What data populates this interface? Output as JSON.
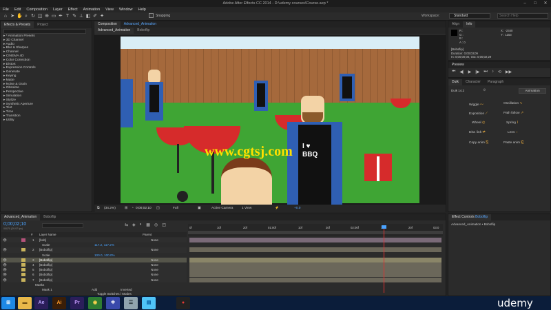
{
  "app": {
    "title": "Adobe After Effects CC 2014 - D:\\udemy courses\\Course.aep *",
    "minimize": "–",
    "maximize": "□",
    "close": "✕"
  },
  "menu": [
    "File",
    "Edit",
    "Composition",
    "Layer",
    "Effect",
    "Animation",
    "View",
    "Window",
    "Help"
  ],
  "toolbar": {
    "snapping_label": "Snapping",
    "workspace_label": "Workspace:",
    "workspace_value": "Standard",
    "search_placeholder": "Search Help"
  },
  "effects_panel": {
    "tabs": [
      "Effects & Presets",
      "Project"
    ],
    "search_placeholder": "",
    "items": [
      "* Animation Presets",
      "3D Channel",
      "Audio",
      "Blur & Sharpen",
      "Channel",
      "CINEMA 4D",
      "Color Correction",
      "Distort",
      "Expression Controls",
      "Generate",
      "Keying",
      "Matte",
      "Noise & Grain",
      "Obsolete",
      "Perspective",
      "Simulation",
      "Stylize",
      "Synthetic Aperture",
      "Text",
      "Time",
      "Transition",
      "Utility"
    ]
  },
  "composition": {
    "panel_title": "Composition",
    "panel_name": "Advanced_Animation",
    "tabs": [
      "Advanced_Animation",
      "Boboflip"
    ],
    "footer": {
      "zoom": "(34.2%)",
      "time": "0;00;02;10",
      "resolution": "Full",
      "camera": "Active Camera",
      "views": "1 View",
      "offset": "+0.0"
    },
    "watermark": "www.cgtsj.com",
    "apron": {
      "heart_line": "I ♥",
      "bbq": "BBQ"
    }
  },
  "info_panel": {
    "tabs": [
      "Align",
      "Info"
    ],
    "readouts": [
      "R :",
      "G :",
      "B :",
      "A : 0"
    ],
    "coords": [
      "X : -2340",
      "Y : 1153"
    ],
    "layer_name": "[Boboflip]",
    "lines": [
      "Duration: 0;00;03;09",
      "In: 0;00;00;00, Out: 0;00;02;29"
    ]
  },
  "preview_panel": {
    "title": "Preview"
  },
  "duik_panel": {
    "tabs": [
      "Duik",
      "Character",
      "Paragraph"
    ],
    "version": "Duik 14.2",
    "dropdown": "Animation",
    "tools": [
      {
        "label": "Wiggle",
        "icon": "〰"
      },
      {
        "label": "Oscillation",
        "icon": "∿"
      },
      {
        "label": "Exposition",
        "icon": "⟋"
      },
      {
        "label": "Path follow",
        "icon": "↗"
      },
      {
        "label": "Wheel",
        "icon": "◴"
      },
      {
        "label": "Spring",
        "icon": "⌇"
      },
      {
        "label": "Dist. link",
        "icon": "⇄"
      },
      {
        "label": "Lens",
        "icon": "◌"
      },
      {
        "label": "Copy anim",
        "icon": "⎘"
      },
      {
        "label": "Paste anim",
        "icon": "⎗"
      }
    ]
  },
  "effect_controls": {
    "title": "Effect Controls",
    "layer": "Boboflip",
    "path": "Advanced_Animation • Boboflip"
  },
  "timeline": {
    "tabs": [
      "Advanced_Animation",
      "Boboflip"
    ],
    "current_time": "0;00;02;10",
    "fps_hint": "00070 (29.97 fps)",
    "search_placeholder": "",
    "col_header": {
      "num": "#",
      "name": "Layer Name",
      "parent": "Parent"
    },
    "ruler": [
      "0f",
      "10f",
      "20f",
      "01:00f",
      "10f",
      "20f",
      "02:00f",
      "10f",
      "20f",
      "03:0"
    ],
    "layers": [
      {
        "num": "1",
        "name": "[bob]",
        "parent": "None",
        "expanded": true
      },
      {
        "num": "",
        "name": "Scale",
        "value": "117.2, 117.2%",
        "prop": true
      },
      {
        "num": "2",
        "name": "[Boboflip]",
        "parent": "None",
        "expanded": true
      },
      {
        "num": "",
        "name": "Scale",
        "value": "100.0, 100.0%",
        "prop": true
      },
      {
        "num": "3",
        "name": "[Boboflip]",
        "parent": "None",
        "selected": true
      },
      {
        "num": "4",
        "name": "[Boboflip]",
        "parent": "None"
      },
      {
        "num": "5",
        "name": "[Boboflip]",
        "parent": "None"
      },
      {
        "num": "6",
        "name": "[Boboflip]",
        "parent": "None"
      },
      {
        "num": "7",
        "name": "[Boboflip]",
        "parent": "None"
      },
      {
        "num": "",
        "name": "Masks",
        "prop": true
      },
      {
        "num": "",
        "name": "Mask 1",
        "mode": "Add",
        "inverted": "Inverted",
        "prop": true
      }
    ],
    "toggle_label": "Toggle Switches / Modes"
  },
  "taskbar": {
    "apps": [
      {
        "name": "start",
        "glyph": "⊞",
        "color": "#1e88e5",
        "fg": "#fff"
      },
      {
        "name": "explorer",
        "glyph": "▬",
        "color": "#e8b84a",
        "fg": "#6a4a10"
      },
      {
        "name": "after-effects",
        "glyph": "Ae",
        "color": "#2b1e5a",
        "fg": "#b9a6ff"
      },
      {
        "name": "illustrator",
        "glyph": "Ai",
        "color": "#3a1e08",
        "fg": "#ff9a2a"
      },
      {
        "name": "premiere",
        "glyph": "Pr",
        "color": "#2b1e5a",
        "fg": "#c79bff"
      },
      {
        "name": "chrome",
        "glyph": "◉",
        "color": "#2e7d32",
        "fg": "#ffd54f"
      },
      {
        "name": "settings",
        "glyph": "✲",
        "color": "#3949ab",
        "fg": "#fff"
      },
      {
        "name": "notes",
        "glyph": "☰",
        "color": "#90a4ae",
        "fg": "#263238"
      },
      {
        "name": "files",
        "glyph": "▤",
        "color": "#4fc3f7",
        "fg": "#01579b"
      },
      {
        "name": "record",
        "glyph": "●",
        "color": "#222",
        "fg": "#e53935"
      }
    ],
    "brand": "udemy"
  }
}
